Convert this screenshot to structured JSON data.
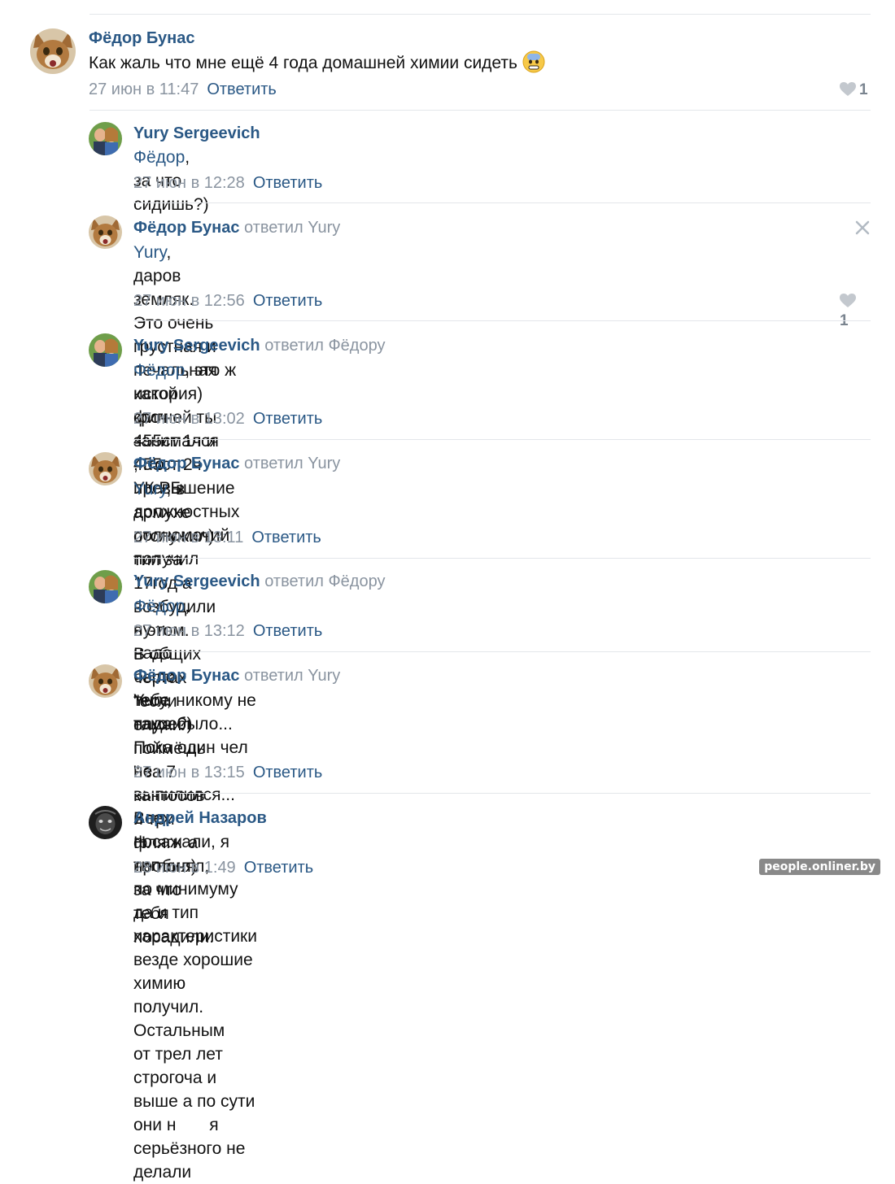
{
  "comments": [
    {
      "author": "Фёдор Бунас",
      "replied_to": "",
      "mention": "",
      "text": "Как жаль что мне ещё 4 года домашней химии сидеть",
      "emoji": "fearful-face-emoji",
      "date": "27 июн в 11:47",
      "reply_label": "Ответить",
      "likes": "1",
      "avatar": "cat-avatar"
    },
    {
      "author": "Yury Sergeevich",
      "replied_to": "",
      "mention": "Фёдор",
      "text": ", за что сидишь?)",
      "date": "27 июн в 12:28",
      "reply_label": "Ответить",
      "avatar": "couple-avatar"
    },
    {
      "author": "Фёдор Бунас",
      "replied_to": "ответил Yury",
      "mention": "Yury",
      "text": ", даров земляк. Это очень грустная и печальная история) кроч 455ст 1ч и\n455ст 2ч УК РБ",
      "date": "27 июн в 12:56",
      "reply_label": "Ответить",
      "likes": "1",
      "avatar": "cat-avatar"
    },
    {
      "author": "Yury Sergeevich",
      "replied_to": "ответил Фёдору",
      "mention": "Фёдор",
      "text": ", это ж какой фигней ты занимался ,что превышение должностных\nполномочий получил",
      "date": "27 июн в 13:02",
      "reply_label": "Ответить",
      "avatar": "couple-avatar"
    },
    {
      "author": "Фёдор Бунас",
      "replied_to": "ответил Yury",
      "mention": "Yury",
      "text": ", в армухе отслужил) тип за 17год а возбудили в этом.\nВ общих чертах \"если служил поймёшь \" за 7 кантосов и три фляги пробил)",
      "date": "27 июн в 13:11",
      "reply_label": "Ответить",
      "avatar": "cat-avatar"
    },
    {
      "author": "Yury Sergeevich",
      "replied_to": "ответил Фёдору",
      "mention": "Фёдор",
      "text": ", ну и надо было тебе такое?)",
      "date": "27 июн в 13:12",
      "reply_label": "Ответить",
      "avatar": "couple-avatar"
    },
    {
      "author": "Фёдор Бунас",
      "replied_to": "ответил Yury",
      "mention": "",
      "text": "Yury, никому не надо было... Пока один чел не выпилился... Всех посажали, я тип\nпо минимуму да и тип характеристики везде хорошие химию получил. Остальным\nот трел лет строгоча и выше а по сути они н       я серьёзного не делали",
      "date": "27 июн в 13:15",
      "reply_label": "Ответить",
      "avatar": "cat-avatar"
    },
    {
      "author": "Андрей Назаров",
      "replied_to": "",
      "mention": "",
      "text": "Н         а не понял, за что тебя посадили.",
      "date": "28 июн в 1:49",
      "reply_label": "Ответить",
      "avatar": "dark-avatar"
    }
  ],
  "watermark": "people.onliner.by",
  "colors": {
    "link": "#2a5885",
    "muted": "#8a94a0",
    "separator": "#e3e6ea"
  }
}
